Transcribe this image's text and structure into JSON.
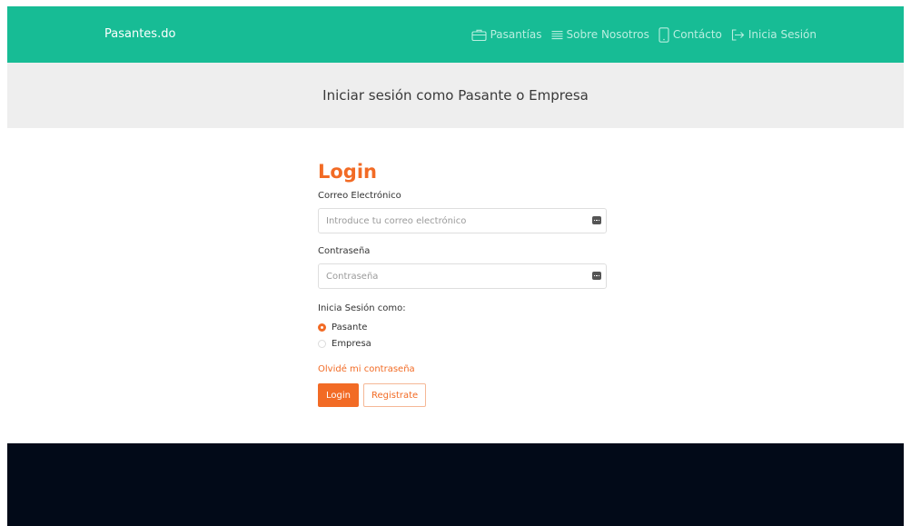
{
  "navbar": {
    "brand": "Pasantes.do",
    "items": [
      {
        "label": "Pasantías",
        "icon": "briefcase-icon"
      },
      {
        "label": "Sobre Nosotros",
        "icon": "list-icon"
      },
      {
        "label": "Contácto",
        "icon": "phone-icon"
      },
      {
        "label": "Inicia Sesión",
        "icon": "sign-in-icon"
      }
    ]
  },
  "banner": {
    "title": "Iniciar sesión como Pasante o Empresa"
  },
  "form": {
    "title": "Login",
    "email_label": "Correo Electrónico",
    "email_placeholder": "Introduce tu correo electrónico",
    "email_value": "",
    "password_label": "Contraseña",
    "password_placeholder": "Contraseña",
    "password_value": "",
    "role_label": "Inicia Sesión como:",
    "roles": [
      {
        "label": "Pasante",
        "checked": true
      },
      {
        "label": "Empresa",
        "checked": false
      }
    ],
    "forgot_link": "Olvidé mi contraseña",
    "login_button": "Login",
    "register_button": "Registrate"
  },
  "colors": {
    "navbar_bg": "#17bc95",
    "accent": "#f26b25",
    "banner_bg": "#eeeeee",
    "footer_bg": "#020a18"
  }
}
